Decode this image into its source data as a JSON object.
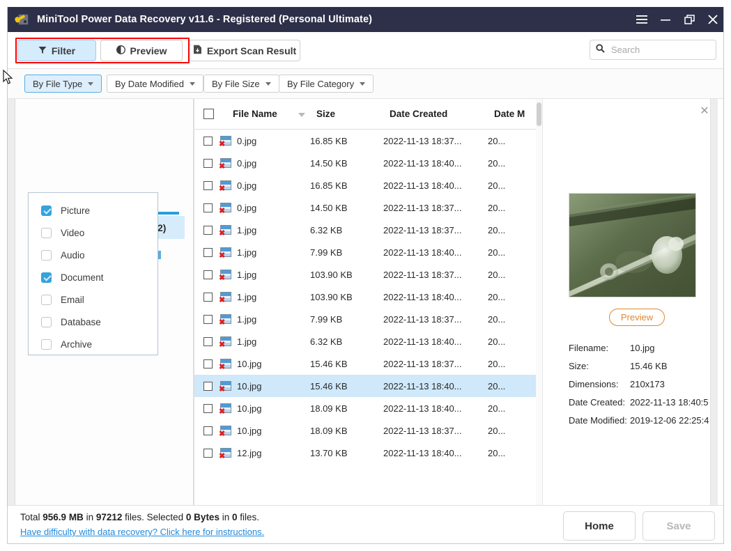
{
  "window": {
    "title": "MiniTool Power Data Recovery v11.6 - Registered (Personal Ultimate)",
    "app_icon": "disk-wrench-icon",
    "controls": [
      {
        "name": "menu-button",
        "icon": "hamburger-menu-icon"
      },
      {
        "name": "minimize-button",
        "icon": "minimize-icon"
      },
      {
        "name": "restore-button",
        "icon": "restore-window-icon"
      },
      {
        "name": "close-button",
        "icon": "close-icon"
      }
    ]
  },
  "toolbar": {
    "filter_label": "Filter",
    "filter_icon": "funnel-icon",
    "preview_label": "Preview",
    "preview_icon": "eye-circle-icon",
    "export_label": "Export Scan Result",
    "export_icon": "export-document-icon",
    "highlight_color": "#ff0000"
  },
  "search": {
    "placeholder": "Search",
    "value": "",
    "icon": "search-icon"
  },
  "filter_bar": {
    "buttons": [
      {
        "label": "By File Type",
        "active": true
      },
      {
        "label": "By Date Modified",
        "active": false
      },
      {
        "label": "By File Size",
        "active": false
      },
      {
        "label": "By File Category",
        "active": false
      }
    ]
  },
  "filter_dropdown": {
    "open_for": "By File Type",
    "items": [
      {
        "label": "Picture",
        "checked": true
      },
      {
        "label": "Video",
        "checked": false
      },
      {
        "label": "Audio",
        "checked": false
      },
      {
        "label": "Document",
        "checked": true
      },
      {
        "label": "Email",
        "checked": false
      },
      {
        "label": "Database",
        "checked": false
      },
      {
        "label": "Archive",
        "checked": false
      }
    ]
  },
  "left_panel": {
    "obscured_tab_fragment": "2)"
  },
  "file_table": {
    "columns": [
      "File Name",
      "Size",
      "Date Created",
      "Date M"
    ],
    "sort_column": "File Name",
    "header_checkbox_checked": false,
    "rows": [
      {
        "name": "0.jpg",
        "size": "16.85 KB",
        "created": "2022-11-13 18:37...",
        "modified": "20...",
        "checked": false,
        "selected": false
      },
      {
        "name": "0.jpg",
        "size": "14.50 KB",
        "created": "2022-11-13 18:40...",
        "modified": "20...",
        "checked": false,
        "selected": false
      },
      {
        "name": "0.jpg",
        "size": "16.85 KB",
        "created": "2022-11-13 18:40...",
        "modified": "20...",
        "checked": false,
        "selected": false
      },
      {
        "name": "0.jpg",
        "size": "14.50 KB",
        "created": "2022-11-13 18:37...",
        "modified": "20...",
        "checked": false,
        "selected": false
      },
      {
        "name": "1.jpg",
        "size": "6.32 KB",
        "created": "2022-11-13 18:37...",
        "modified": "20...",
        "checked": false,
        "selected": false
      },
      {
        "name": "1.jpg",
        "size": "7.99 KB",
        "created": "2022-11-13 18:40...",
        "modified": "20...",
        "checked": false,
        "selected": false
      },
      {
        "name": "1.jpg",
        "size": "103.90 KB",
        "created": "2022-11-13 18:37...",
        "modified": "20...",
        "checked": false,
        "selected": false
      },
      {
        "name": "1.jpg",
        "size": "103.90 KB",
        "created": "2022-11-13 18:40...",
        "modified": "20...",
        "checked": false,
        "selected": false
      },
      {
        "name": "1.jpg",
        "size": "7.99 KB",
        "created": "2022-11-13 18:37...",
        "modified": "20...",
        "checked": false,
        "selected": false
      },
      {
        "name": "1.jpg",
        "size": "6.32 KB",
        "created": "2022-11-13 18:40...",
        "modified": "20...",
        "checked": false,
        "selected": false
      },
      {
        "name": "10.jpg",
        "size": "15.46 KB",
        "created": "2022-11-13 18:37...",
        "modified": "20...",
        "checked": false,
        "selected": false
      },
      {
        "name": "10.jpg",
        "size": "15.46 KB",
        "created": "2022-11-13 18:40...",
        "modified": "20...",
        "checked": false,
        "selected": true
      },
      {
        "name": "10.jpg",
        "size": "18.09 KB",
        "created": "2022-11-13 18:40...",
        "modified": "20...",
        "checked": false,
        "selected": false
      },
      {
        "name": "10.jpg",
        "size": "18.09 KB",
        "created": "2022-11-13 18:37...",
        "modified": "20...",
        "checked": false,
        "selected": false
      },
      {
        "name": "12.jpg",
        "size": "13.70 KB",
        "created": "2022-11-13 18:40...",
        "modified": "20...",
        "checked": false,
        "selected": false
      }
    ]
  },
  "preview": {
    "close_icon": "close-icon",
    "image_alt": "green-leaf-with-water-droplets",
    "preview_button_label": "Preview",
    "preview_button_color": "#e0872f",
    "details": [
      {
        "label": "Filename:",
        "value": "10.jpg"
      },
      {
        "label": "Size:",
        "value": "15.46 KB"
      },
      {
        "label": "Dimensions:",
        "value": "210x173"
      },
      {
        "label": "Date Created:",
        "value": "2022-11-13 18:40:5"
      },
      {
        "label": "Date Modified:",
        "value": "2019-12-06 22:25:4"
      }
    ]
  },
  "footer": {
    "status_prefix": "Total ",
    "total_size": "956.9 MB",
    "status_mid1": " in ",
    "total_files": "97212",
    "status_mid2": " files.  Selected ",
    "selected_size": "0 Bytes",
    "status_mid3": " in ",
    "selected_files": "0",
    "status_suffix": " files.",
    "help_link": "Have difficulty with data recovery? Click here for instructions.",
    "home_label": "Home",
    "save_label": "Save"
  }
}
